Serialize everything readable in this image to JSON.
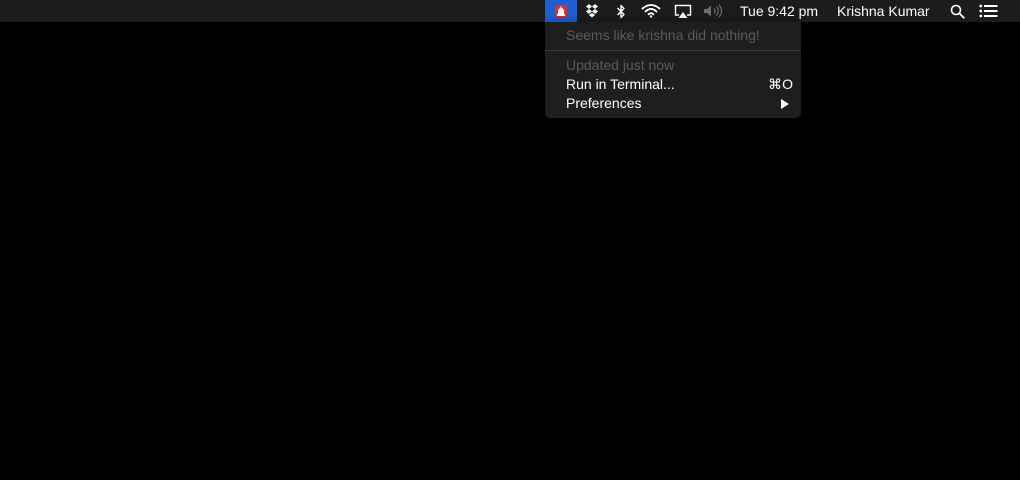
{
  "menubar": {
    "status_icons": [
      {
        "name": "siren-app-icon",
        "active": true
      },
      {
        "name": "dropbox-icon"
      },
      {
        "name": "bluetooth-icon"
      },
      {
        "name": "wifi-icon"
      },
      {
        "name": "airplay-icon"
      },
      {
        "name": "volume-icon"
      }
    ],
    "clock": "Tue 9:42 pm",
    "user": "Krishna Kumar",
    "spotlight_icon": "search-icon",
    "notification_icon": "notification-center-icon",
    "active_color": "#1f5fd1"
  },
  "menu": {
    "status_message": "Seems like krishna did nothing!",
    "updated": "Updated just now",
    "run_in_terminal": "Run in Terminal...",
    "run_shortcut": "⌘O",
    "preferences": "Preferences"
  }
}
